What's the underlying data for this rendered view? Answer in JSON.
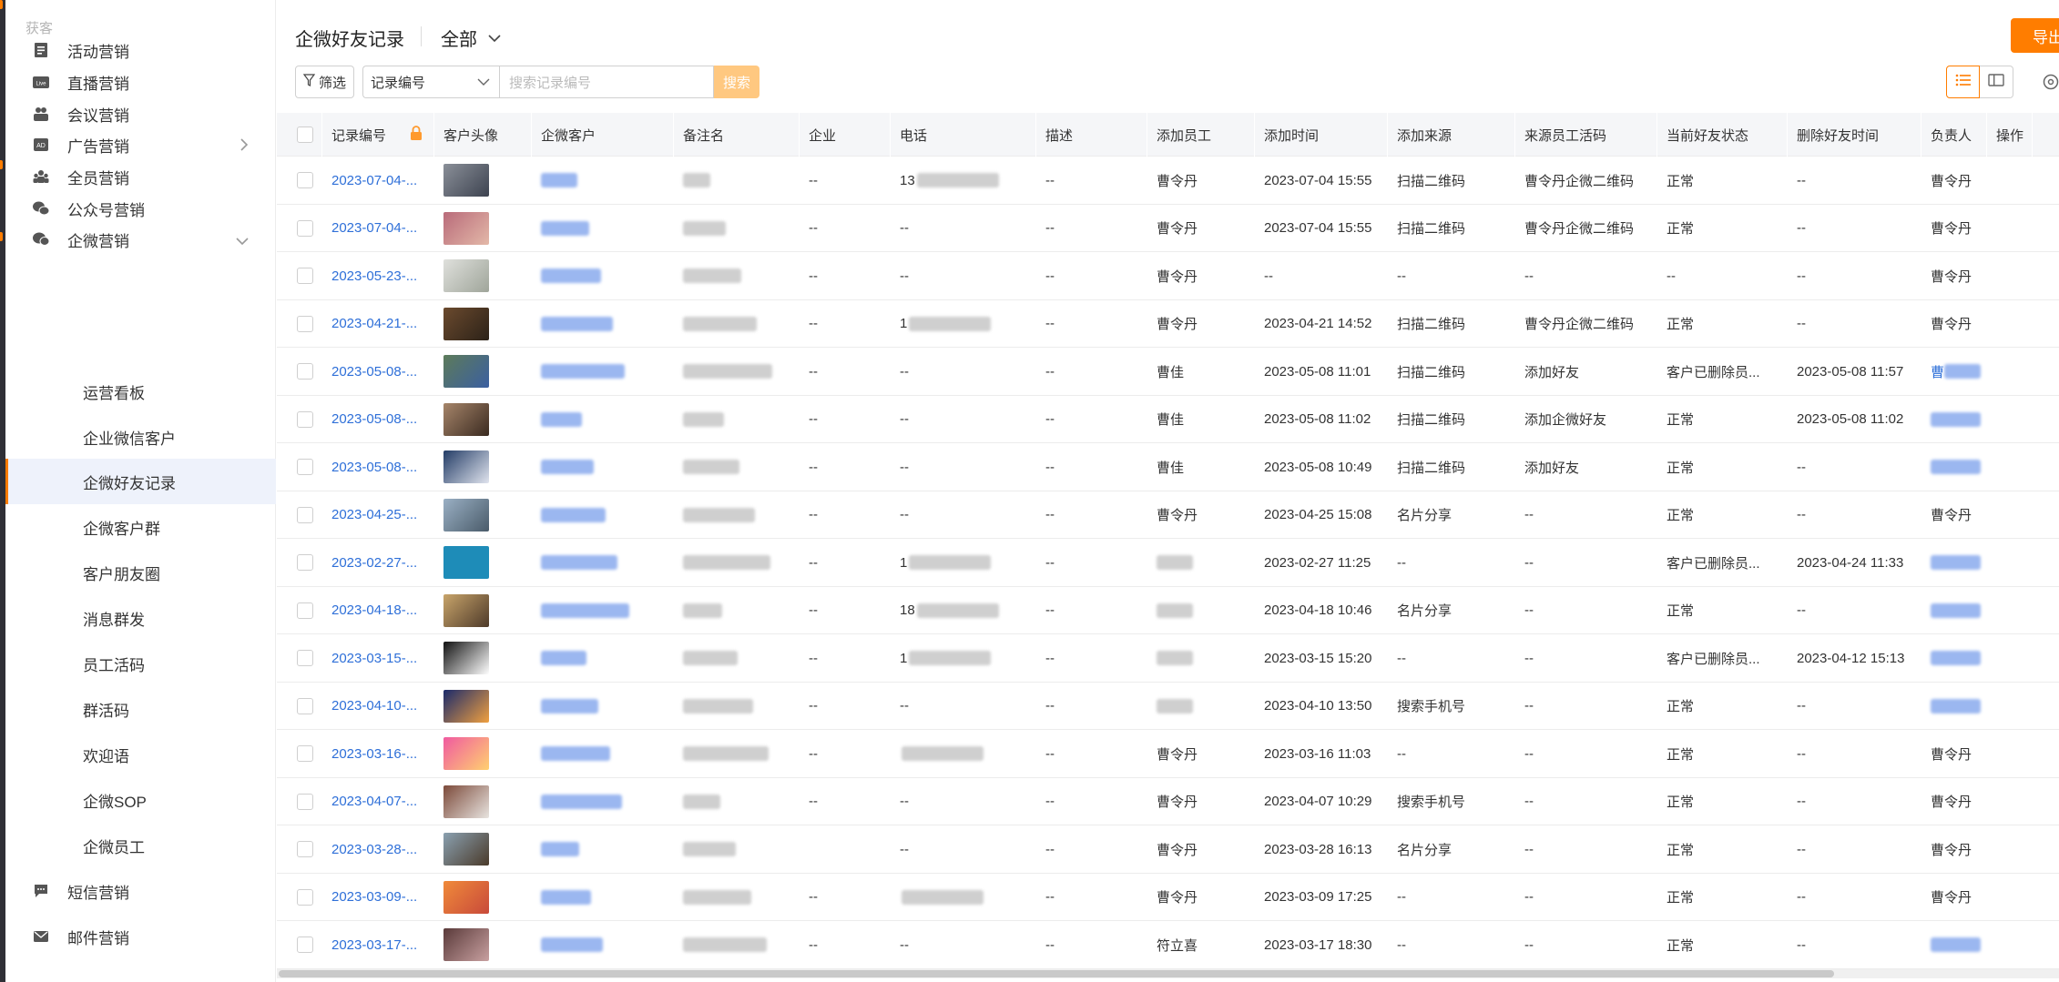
{
  "sidebar": {
    "section_label": "获客",
    "items": [
      {
        "label": "活动营销",
        "icon": "document-icon"
      },
      {
        "label": "直播营销",
        "icon": "live-icon"
      },
      {
        "label": "会议营销",
        "icon": "meeting-icon"
      },
      {
        "label": "广告营销",
        "icon": "ad-icon",
        "expandable": true
      },
      {
        "label": "全员营销",
        "icon": "team-icon"
      },
      {
        "label": "公众号营销",
        "icon": "wechat-icon"
      },
      {
        "label": "企微营销",
        "icon": "chat-icon",
        "expanded": true
      }
    ],
    "sub_items": [
      {
        "label": "运营看板"
      },
      {
        "label": "企业微信客户"
      },
      {
        "label": "企微好友记录",
        "active": true
      },
      {
        "label": "企微客户群"
      },
      {
        "label": "客户朋友圈"
      },
      {
        "label": "消息群发"
      },
      {
        "label": "员工活码"
      },
      {
        "label": "群活码"
      },
      {
        "label": "欢迎语"
      },
      {
        "label": "企微SOP"
      },
      {
        "label": "企微员工"
      }
    ],
    "bottom_items": [
      {
        "label": "短信营销",
        "icon": "sms-icon"
      },
      {
        "label": "邮件营销",
        "icon": "mail-icon"
      }
    ]
  },
  "header": {
    "title": "企微好友记录",
    "filter_value": "全部",
    "export_label": "导出"
  },
  "toolbar": {
    "filter_label": "筛选",
    "search_field_select": "记录编号",
    "search_placeholder": "搜索记录编号",
    "search_button": "搜索"
  },
  "table": {
    "columns": [
      "记录编号",
      "客户头像",
      "企微客户",
      "备注名",
      "企业",
      "电话",
      "描述",
      "添加员工",
      "添加时间",
      "添加来源",
      "来源员工活码",
      "当前好友状态",
      "删除好友时间",
      "负责人",
      "操作"
    ],
    "rows": [
      {
        "id": "2023-07-04-...",
        "company": "--",
        "phone": "13",
        "desc": "--",
        "staff": "曹令丹",
        "time": "2023-07-04 15:55",
        "source": "扫描二维码",
        "code": "曹令丹企微二维码",
        "status": "正常",
        "deleted": "--",
        "owner": "曹令丹"
      },
      {
        "id": "2023-07-04-...",
        "company": "--",
        "phone": "--",
        "desc": "--",
        "staff": "曹令丹",
        "time": "2023-07-04 15:55",
        "source": "扫描二维码",
        "code": "曹令丹企微二维码",
        "status": "正常",
        "deleted": "--",
        "owner": "曹令丹"
      },
      {
        "id": "2023-05-23-...",
        "company": "--",
        "phone": "--",
        "desc": "--",
        "staff": "曹令丹",
        "time": "--",
        "source": "--",
        "code": "--",
        "status": "--",
        "deleted": "--",
        "owner": "曹令丹"
      },
      {
        "id": "2023-04-21-...",
        "company": "--",
        "phone": "1",
        "desc": "--",
        "staff": "曹令丹",
        "time": "2023-04-21 14:52",
        "source": "扫描二维码",
        "code": "曹令丹企微二维码",
        "status": "正常",
        "deleted": "--",
        "owner": "曹令丹"
      },
      {
        "id": "2023-05-08-...",
        "company": "--",
        "phone": "--",
        "desc": "--",
        "staff": "曹佳",
        "time": "2023-05-08 11:01",
        "source": "扫描二维码",
        "code": "添加好友",
        "status": "客户已删除员...",
        "deleted": "2023-05-08 11:57",
        "owner": "曹"
      },
      {
        "id": "2023-05-08-...",
        "company": "--",
        "phone": "--",
        "desc": "--",
        "staff": "曹佳",
        "time": "2023-05-08 11:02",
        "source": "扫描二维码",
        "code": "添加企微好友",
        "status": "正常",
        "deleted": "2023-05-08 11:02",
        "owner": ""
      },
      {
        "id": "2023-05-08-...",
        "company": "--",
        "phone": "--",
        "desc": "--",
        "staff": "曹佳",
        "time": "2023-05-08 10:49",
        "source": "扫描二维码",
        "code": "添加好友",
        "status": "正常",
        "deleted": "--",
        "owner": ""
      },
      {
        "id": "2023-04-25-...",
        "company": "--",
        "phone": "--",
        "desc": "--",
        "staff": "曹令丹",
        "time": "2023-04-25 15:08",
        "source": "名片分享",
        "code": "--",
        "status": "正常",
        "deleted": "--",
        "owner": "曹令丹"
      },
      {
        "id": "2023-02-27-...",
        "company": "--",
        "phone": "1",
        "desc": "--",
        "staff": "",
        "time": "2023-02-27 11:25",
        "source": "--",
        "code": "--",
        "status": "客户已删除员...",
        "deleted": "2023-04-24 11:33",
        "owner": ""
      },
      {
        "id": "2023-04-18-...",
        "company": "--",
        "phone": "18",
        "desc": "--",
        "staff": "",
        "time": "2023-04-18 10:46",
        "source": "名片分享",
        "code": "--",
        "status": "正常",
        "deleted": "--",
        "owner": ""
      },
      {
        "id": "2023-03-15-...",
        "company": "--",
        "phone": "1",
        "desc": "--",
        "staff": "",
        "time": "2023-03-15 15:20",
        "source": "--",
        "code": "--",
        "status": "客户已删除员...",
        "deleted": "2023-04-12 15:13",
        "owner": ""
      },
      {
        "id": "2023-04-10-...",
        "company": "--",
        "phone": "--",
        "desc": "--",
        "staff": "",
        "time": "2023-04-10 13:50",
        "source": "搜索手机号",
        "code": "--",
        "status": "正常",
        "deleted": "--",
        "owner": ""
      },
      {
        "id": "2023-03-16-...",
        "company": "--",
        "phone": "",
        "desc": "--",
        "staff": "曹令丹",
        "time": "2023-03-16 11:03",
        "source": "--",
        "code": "--",
        "status": "正常",
        "deleted": "--",
        "owner": "曹令丹"
      },
      {
        "id": "2023-04-07-...",
        "company": "--",
        "phone": "--",
        "desc": "--",
        "staff": "曹令丹",
        "time": "2023-04-07 10:29",
        "source": "搜索手机号",
        "code": "--",
        "status": "正常",
        "deleted": "--",
        "owner": "曹令丹"
      },
      {
        "id": "2023-03-28-...",
        "company": "",
        "phone": "--",
        "desc": "--",
        "staff": "曹令丹",
        "time": "2023-03-28 16:13",
        "source": "名片分享",
        "code": "--",
        "status": "正常",
        "deleted": "--",
        "owner": "曹令丹"
      },
      {
        "id": "2023-03-09-...",
        "company": "--",
        "phone": "",
        "desc": "--",
        "staff": "曹令丹",
        "time": "2023-03-09 17:25",
        "source": "--",
        "code": "--",
        "status": "正常",
        "deleted": "--",
        "owner": "曹令丹"
      },
      {
        "id": "2023-03-17-...",
        "company": "--",
        "phone": "--",
        "desc": "--",
        "staff": "符立喜",
        "time": "2023-03-17 18:30",
        "source": "--",
        "code": "--",
        "status": "正常",
        "deleted": "--",
        "owner": ""
      }
    ]
  },
  "colors": {
    "accent": "#ff7d00",
    "link": "#2e6fd8",
    "active_bg": "#eef2fb",
    "header_bg": "#f5f6f8"
  }
}
